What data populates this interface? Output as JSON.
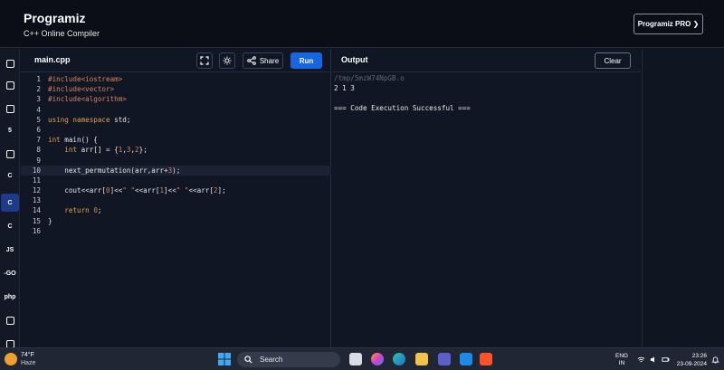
{
  "header": {
    "logo_text": "Programiz",
    "subtitle": "C++ Online Compiler",
    "pro_button": "Programiz PRO ❯"
  },
  "sidebar": {
    "items": [
      {
        "name": "python",
        "label": "",
        "icon": "python-icon"
      },
      {
        "name": "r",
        "label": "",
        "icon": "r-icon"
      },
      {
        "name": "sql",
        "label": "",
        "icon": "database-icon"
      },
      {
        "name": "html",
        "label": "5",
        "icon": "html-icon"
      },
      {
        "name": "java",
        "label": "",
        "icon": "java-icon"
      },
      {
        "name": "c",
        "label": "C",
        "icon": "c-icon"
      },
      {
        "name": "cpp",
        "label": "C",
        "icon": "cpp-icon",
        "active": true
      },
      {
        "name": "csharp",
        "label": "C",
        "icon": "csharp-icon"
      },
      {
        "name": "js",
        "label": "JS",
        "icon": "js-icon"
      },
      {
        "name": "go",
        "label": "-GO",
        "icon": "go-icon"
      },
      {
        "name": "php",
        "label": "php",
        "icon": "php-icon"
      },
      {
        "name": "swift",
        "label": "",
        "icon": "swift-icon"
      },
      {
        "name": "rust",
        "label": "",
        "icon": "rust-icon"
      }
    ]
  },
  "editor": {
    "file_name": "main.cpp",
    "share_label": "Share",
    "run_label": "Run",
    "lines": [
      {
        "n": "1",
        "html": "<span class=\"inc\">#include&lt;iostream&gt;</span>"
      },
      {
        "n": "2",
        "html": "<span class=\"inc\">#include&lt;vector&gt;</span>"
      },
      {
        "n": "3",
        "html": "<span class=\"inc\">#include&lt;algorithm&gt;</span>"
      },
      {
        "n": "4",
        "html": ""
      },
      {
        "n": "5",
        "html": "<span class=\"kw\">using namespace</span> std;"
      },
      {
        "n": "6",
        "html": ""
      },
      {
        "n": "7",
        "html": "<span class=\"kw\">int</span> main() {"
      },
      {
        "n": "8",
        "html": "    <span class=\"kw\">int</span> arr[] = {<span class=\"num\">1</span>,<span class=\"num\">3</span>,<span class=\"num\">2</span>};"
      },
      {
        "n": "9",
        "html": ""
      },
      {
        "n": "10",
        "html": "    next_permutation(arr,arr+<span class=\"num\">3</span>);",
        "highlight": true
      },
      {
        "n": "11",
        "html": ""
      },
      {
        "n": "12",
        "html": "    cout&lt;&lt;arr[<span class=\"num\">0</span>]&lt;&lt;<span class=\"num\">\" \"</span>&lt;&lt;arr[<span class=\"num\">1</span>]&lt;&lt;<span class=\"num\">\" \"</span>&lt;&lt;arr[<span class=\"num\">2</span>];"
      },
      {
        "n": "13",
        "html": ""
      },
      {
        "n": "14",
        "html": "    <span class=\"kw\">return</span> <span class=\"num\">0</span>;"
      },
      {
        "n": "15",
        "html": "}"
      },
      {
        "n": "16",
        "html": ""
      }
    ]
  },
  "output": {
    "title": "Output",
    "clear_label": "Clear",
    "path": "/tmp/5mzW74NpGB.o",
    "result": "2 1 3",
    "success": "=== Code Execution Successful ==="
  },
  "taskbar": {
    "temperature": "74°F",
    "weather": "Haze",
    "search_placeholder": "Search",
    "lang_top": "ENG",
    "lang_bottom": "IN",
    "time": "23:26",
    "date": "23-09-2024"
  },
  "colors": {
    "run_button": "#1566e0",
    "background": "#111624",
    "keyword": "#e6a04a"
  }
}
